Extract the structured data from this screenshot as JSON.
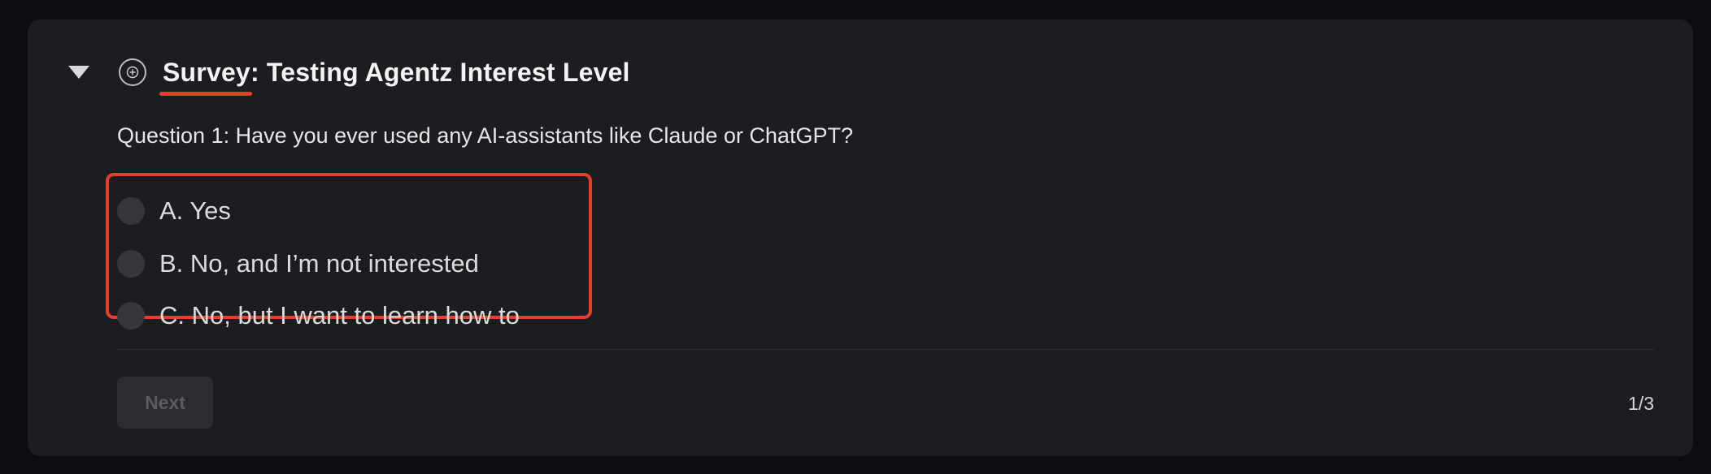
{
  "survey": {
    "title_prefix": "Survey",
    "title_rest": ": Testing Agentz Interest Level",
    "question": "Question 1: Have you ever used any AI-assistants like Claude or ChatGPT?",
    "options": [
      {
        "label": "A. Yes"
      },
      {
        "label": "B. No, and I’m not interested"
      },
      {
        "label": "C. No, but I want to learn how to"
      }
    ],
    "next_label": "Next",
    "pager": "1/3"
  },
  "colors": {
    "accent_red": "#e2402b",
    "card_bg": "#1c1d21",
    "page_bg": "#0c0d10"
  },
  "icons": {
    "collapse": "caret-down-icon",
    "add": "plus-circle-icon"
  }
}
